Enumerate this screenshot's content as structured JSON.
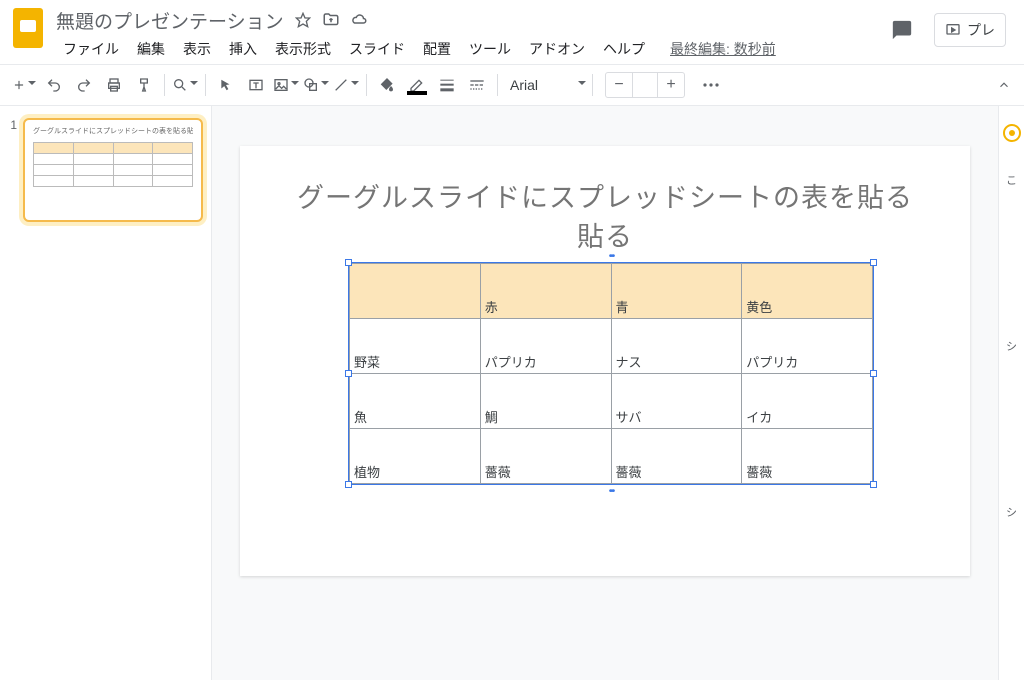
{
  "header": {
    "title": "無題のプレゼンテーション",
    "last_edit": "最終編集: 数秒前",
    "present_label": "プレ"
  },
  "menus": [
    "ファイル",
    "編集",
    "表示",
    "挿入",
    "表示形式",
    "スライド",
    "配置",
    "ツール",
    "アドオン",
    "ヘルプ"
  ],
  "toolbar": {
    "font": "Arial"
  },
  "filmstrip": {
    "slide_number": "1",
    "thumb_title": "グーグルスライドにスプレッドシートの表を貼る貼る"
  },
  "slide": {
    "title": "グーグルスライドにスプレッドシートの表を貼る貼る",
    "table": [
      [
        "",
        "赤",
        "青",
        "黄色"
      ],
      [
        "野菜",
        "パプリカ",
        "ナス",
        "パプリカ"
      ],
      [
        "魚",
        "鯛",
        "サバ",
        "イカ"
      ],
      [
        "植物",
        "薔薇",
        "薔薇",
        "薔薇"
      ]
    ]
  },
  "sidepanel": {
    "ch": "こ",
    "s1": "シ",
    "s2": "シ"
  }
}
